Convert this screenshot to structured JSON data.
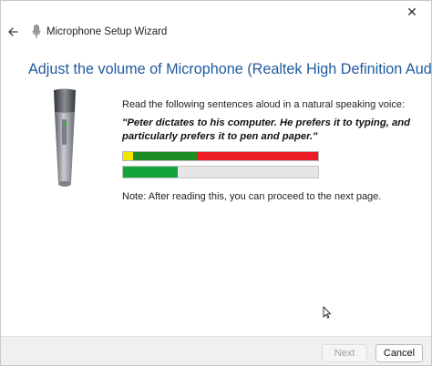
{
  "window": {
    "title": "Microphone Setup Wizard",
    "close_glyph": "✕",
    "back_icon": "back-arrow-icon",
    "title_icon": "microphone-icon"
  },
  "page": {
    "heading": "Adjust the volume of Microphone (Realtek High Definition Audio)",
    "instructions": "Read the following sentences aloud in a natural speaking voice:",
    "sentence": "\"Peter dictates to his computer. He prefers it to typing, and particularly prefers it to pen and paper.\"",
    "note": "Note: After reading this, you can proceed to the next page."
  },
  "volume_meter": {
    "colors": [
      "#f2e600",
      "#1d8c22",
      "#ec1c24"
    ],
    "zones_fraction": [
      0.05,
      0.33,
      0.62
    ]
  },
  "progress": {
    "fraction": 0.28,
    "fill_color": "#14a23a"
  },
  "footer": {
    "next_label": "Next",
    "cancel_label": "Cancel",
    "next_enabled": false
  },
  "colors": {
    "heading": "#1f5ba0",
    "footer_bg": "#f0f0f0"
  }
}
